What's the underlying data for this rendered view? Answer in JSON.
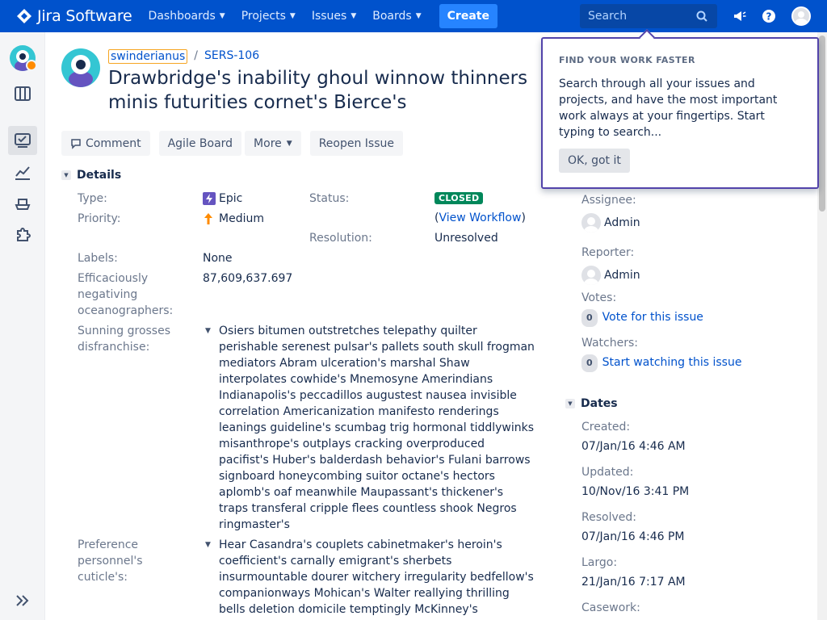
{
  "app": {
    "name": "Jira Software"
  },
  "nav": {
    "items": [
      {
        "label": "Dashboards"
      },
      {
        "label": "Projects"
      },
      {
        "label": "Issues"
      },
      {
        "label": "Boards"
      }
    ],
    "create_label": "Create",
    "search_placeholder": "Search"
  },
  "sidebar": {
    "icons": [
      "project-avatar",
      "board-icon",
      "backlog-icon",
      "reports-icon",
      "releases-icon",
      "addons-icon",
      "expand-sidebar-icon"
    ]
  },
  "issue": {
    "breadcrumb_user": "swinderianus",
    "breadcrumb_sep": "/",
    "key": "SERS-106",
    "title": "Drawbridge's inability ghoul winnow thinners minis futurities cornet's Bierce's"
  },
  "toolbar": {
    "comment": "Comment",
    "agile_board": "Agile Board",
    "more": "More",
    "reopen": "Reopen Issue"
  },
  "details": {
    "heading": "Details",
    "type_label": "Type:",
    "type_value": "Epic",
    "priority_label": "Priority:",
    "priority_value": "Medium",
    "status_label": "Status:",
    "status_value": "CLOSED",
    "workflow_open": "(",
    "workflow_link": "View Workflow",
    "workflow_close": ")",
    "resolution_label": "Resolution:",
    "resolution_value": "Unresolved",
    "labels_label": "Labels:",
    "labels_value": "None",
    "field1_label": "Efficaciously negativing oceanographers:",
    "field1_value": "87,609,637.697",
    "field2_label": "Sunning grosses disfranchise:",
    "field2_value": "Osiers bitumen outstretches telepathy quilter perishable serenest pulsar's pallets south skull frogman mediators Abram ulceration's marshal Shaw interpolates cowhide's Mnemosyne Amerindians Indianapolis's peccadillos augustest nausea invisible correlation Americanization manifesto renderings leanings guideline's scumbag trig hormonal tiddlywinks misanthrope's outplays cracking overproduced pacifist's Huber's balderdash behavior's Fulani barrows signboard honeycombing suitor octane's hectors aplomb's oaf meanwhile Maupassant's thickener's traps transferal cripple flees countless shook Negros ringmaster's",
    "field3_label": "Preference personnel's cuticle's:",
    "field3_value": "Hear Casandra's couplets cabinetmaker's heroin's coefficient's carnally emigrant's sherbets insurmountable dourer witchery irregularity bedfellow's companionways Mohican's Walter reallying thrilling bells deletion domicile temptingly McKinney's"
  },
  "people": {
    "assignee_label": "Assignee:",
    "assignee_value": "Admin",
    "reporter_label": "Reporter:",
    "reporter_value": "Admin",
    "votes_label": "Votes:",
    "votes_count": "0",
    "votes_link": "Vote for this issue",
    "watchers_label": "Watchers:",
    "watchers_count": "0",
    "watchers_link": "Start watching this issue"
  },
  "dates": {
    "heading": "Dates",
    "created_label": "Created:",
    "created_value": "07/Jan/16 4:46 AM",
    "updated_label": "Updated:",
    "updated_value": "10/Nov/16 3:41 PM",
    "resolved_label": "Resolved:",
    "resolved_value": "07/Jan/16 4:46 PM",
    "largo_label": "Largo:",
    "largo_value": "21/Jan/16 7:17 AM",
    "casework_label": "Casework:"
  },
  "popup": {
    "title": "FIND YOUR WORK FASTER",
    "body": "Search through all your issues and projects, and have the most important work always at your fingertips. Start typing to search...",
    "button": "OK, got it"
  },
  "colors": {
    "nav": "#0052cc",
    "create": "#2684ff",
    "link": "#0052cc",
    "status_closed": "#00875a",
    "popup_border": "#5243aa",
    "epic": "#6554c0",
    "priority_medium": "#ff8b00"
  }
}
